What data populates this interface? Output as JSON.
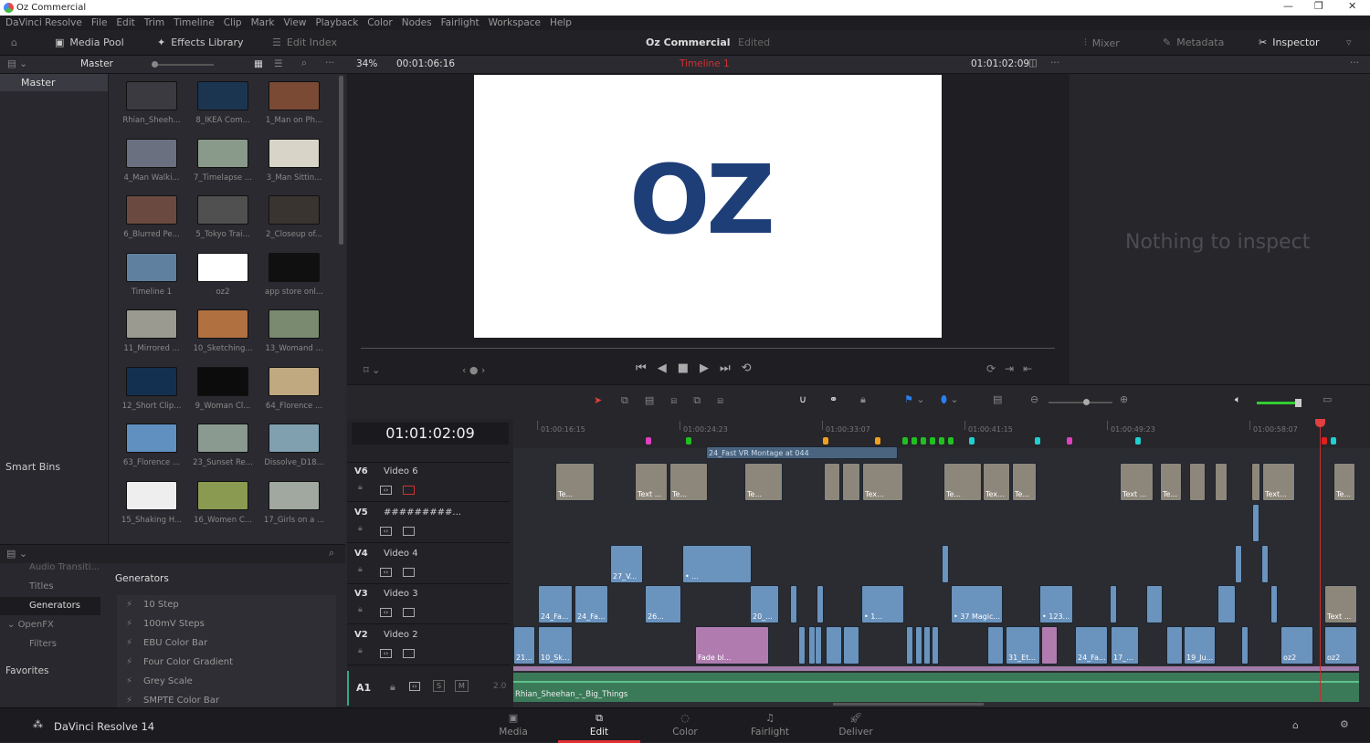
{
  "window": {
    "title": "Oz Commercial",
    "minimize": "—",
    "maximize": "❐",
    "close": "✕"
  },
  "menu": [
    "DaVinci Resolve",
    "File",
    "Edit",
    "Trim",
    "Timeline",
    "Clip",
    "Mark",
    "View",
    "Playback",
    "Color",
    "Nodes",
    "Fairlight",
    "Workspace",
    "Help"
  ],
  "toolbar": {
    "media_pool": "Media Pool",
    "effects_library": "Effects Library",
    "edit_index": "Edit Index",
    "project_name": "Oz Commercial",
    "project_status": "Edited",
    "mixer": "Mixer",
    "metadata": "Metadata",
    "inspector": "Inspector"
  },
  "subbar": {
    "bin": "Master",
    "zoom": "34%",
    "source_timecode": "00:01:06:16",
    "timeline_name": "Timeline 1",
    "record_timecode": "01:01:02:09"
  },
  "left_pane": {
    "master": "Master",
    "smart_bins": "Smart Bins"
  },
  "media_pool": [
    "Rhian_Sheeh...",
    "8_IKEA Com...",
    "1_Man on Ph...",
    "4_Man Walki...",
    "7_Timelapse ...",
    "3_Man Sittin...",
    "6_Blurred Pe...",
    "5_Tokyo Trai...",
    "2_Closeup of...",
    "Timeline 1",
    "oz2",
    "app store onl...",
    "11_Mirrored ...",
    "10_Sketching...",
    "13_Womand ...",
    "12_Short Clip...",
    "9_Woman Cl...",
    "64_Florence ...",
    "63_Florence ...",
    "23_Sunset Re...",
    "Dissolve_D18...",
    "15_Shaking H...",
    "16_Women C...",
    "17_Girls on a ..."
  ],
  "thumb_colors": [
    "#3a3a40",
    "#1b3550",
    "#7a4a35",
    "#6a7080",
    "#8a9a8a",
    "#d8d4c8",
    "#6a4a40",
    "#505050",
    "#3a3430",
    "#6080a0",
    "#ffffff",
    "#101010",
    "#9a9a90",
    "#b07040",
    "#7a8a70",
    "#143050",
    "#0c0c0c",
    "#c0a880",
    "#6090c0",
    "#8a9a90",
    "#80a0b0",
    "#eeeeee",
    "#8a9a50",
    "#a0a8a0"
  ],
  "effects": {
    "tree": [
      "Audio Transiti...",
      "Titles",
      "Generators",
      "OpenFX",
      "Filters"
    ],
    "favorites": "Favorites",
    "heading": "Generators",
    "items": [
      "10 Step",
      "100mV Steps",
      "EBU Color Bar",
      "Four Color Gradient",
      "Grey Scale",
      "SMPTE Color Bar"
    ]
  },
  "viewer": {
    "logo_text": "OZ"
  },
  "inspector": {
    "empty_text": "Nothing to inspect"
  },
  "timeline": {
    "timecode": "01:01:02:09",
    "ruler": [
      "01:00:16:15",
      "01:00:24:23",
      "01:00:33:07",
      "01:00:41:15",
      "01:00:49:23",
      "01:00:58:07"
    ],
    "tracks": [
      {
        "id": "V6",
        "name": "Video 6"
      },
      {
        "id": "V5",
        "name": "#########..."
      },
      {
        "id": "V4",
        "name": "Video 4"
      },
      {
        "id": "V3",
        "name": "Video 3"
      },
      {
        "id": "V2",
        "name": "Video 2"
      }
    ],
    "audio": {
      "id": "A1",
      "solo": "S",
      "mute": "M",
      "channels": "2.0",
      "clip": "Rhian_Sheehan_-_Big_Things"
    },
    "compound_clip": "24_Fast VR Montage at 044",
    "marker_colors": {
      "pink": "#e040c0",
      "green": "#20c020",
      "orange": "#f0a020",
      "cyan": "#20d0d0",
      "red": "#e02020",
      "blue": "#2080f0"
    },
    "clips": {
      "v6": [
        "Te...",
        "Text ...",
        "Te...",
        "Te...",
        "Tex...",
        "Te...",
        "Tex...",
        "Te...",
        "Text ...",
        "Te...",
        "Text...",
        "Te..."
      ],
      "v4": [
        "27_V...",
        "• ..."
      ],
      "v3": [
        "24_Fa...",
        "24_Fa...",
        "26...",
        "20_...",
        "• 1...",
        "• 37 Magic...",
        "• 123...",
        "Text ..."
      ],
      "v2": [
        "21...",
        "10_Sk...",
        "Fade bl...",
        "31_Et...",
        "24_Fa...",
        "17_...",
        "19_Ju...",
        "oz2",
        "oz2"
      ]
    }
  },
  "pages": [
    "Media",
    "Edit",
    "Color",
    "Fairlight",
    "Deliver"
  ],
  "app": {
    "name": "DaVinci Resolve 14"
  }
}
